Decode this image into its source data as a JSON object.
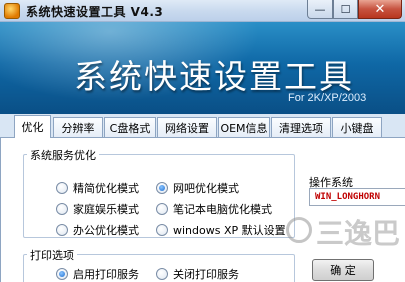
{
  "window": {
    "title": "系统快速设置工具 V4.3",
    "min_symbol": "—",
    "max_symbol": "☐",
    "close_symbol": "✕"
  },
  "banner": {
    "title": "系统快速设置工具",
    "subtitle": "For 2K/XP/2003"
  },
  "tabs": [
    "优化",
    "分辨率",
    "C盘格式",
    "网络设置",
    "OEM信息",
    "清理选项",
    "小键盘"
  ],
  "active_tab": "优化",
  "services": {
    "label": "系统服务优化",
    "options": [
      {
        "label": "精简优化模式",
        "checked": false
      },
      {
        "label": "网吧优化模式",
        "checked": true
      },
      {
        "label": "家庭娱乐模式",
        "checked": false
      },
      {
        "label": "笔记本电脑优化模式",
        "checked": false
      },
      {
        "label": "办公优化模式",
        "checked": false
      },
      {
        "label": "windows XP 默认设置",
        "checked": false
      }
    ]
  },
  "os": {
    "label": "操作系统",
    "value": "WIN_LONGHORN"
  },
  "print": {
    "label": "打印选项",
    "options": [
      {
        "label": "启用打印服务",
        "checked": true
      },
      {
        "label": "关闭打印服务",
        "checked": false
      }
    ]
  },
  "ok_button": "确 定",
  "watermark": "三逸巴",
  "icons": {
    "app": "app-gear-icon",
    "minimize": "minimize-icon",
    "maximize": "maximize-icon",
    "close": "close-icon"
  },
  "colors": {
    "banner": "#0f68a6",
    "os_value": "#c00000",
    "radio_checked": "#1f6fd1"
  }
}
